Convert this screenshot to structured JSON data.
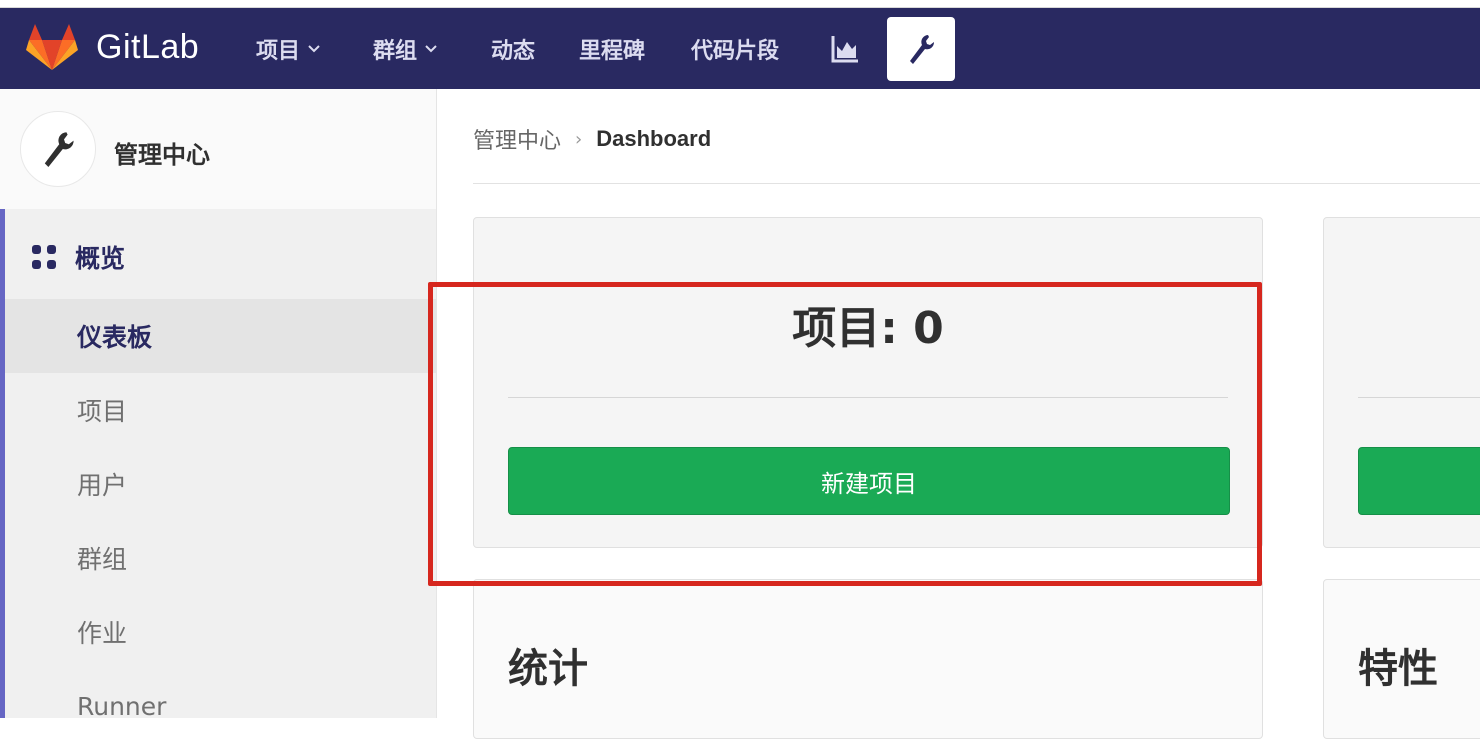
{
  "app": {
    "brand": "GitLab"
  },
  "nav": {
    "items": [
      {
        "label": "项目",
        "has_dropdown": true
      },
      {
        "label": "群组",
        "has_dropdown": true
      },
      {
        "label": "动态"
      },
      {
        "label": "里程碑"
      },
      {
        "label": "代码片段"
      }
    ],
    "chart_icon": "chart-icon",
    "admin_icon": "wrench-icon"
  },
  "sidebar": {
    "title": "管理中心",
    "section_label": "概览",
    "items": [
      {
        "label": "仪表板",
        "active": true
      },
      {
        "label": "项目"
      },
      {
        "label": "用户"
      },
      {
        "label": "群组"
      },
      {
        "label": "作业"
      },
      {
        "label": "Runner"
      }
    ]
  },
  "breadcrumb": {
    "parent": "管理中心",
    "current": "Dashboard"
  },
  "projects_card": {
    "count_text": "项目: 0",
    "button_label": "新建项目"
  },
  "stats_card": {
    "title": "统计"
  },
  "features_card": {
    "title": "特性"
  },
  "colors": {
    "navbar": "#292961",
    "accent": "#1aaa55",
    "highlight": "#d6271e"
  }
}
